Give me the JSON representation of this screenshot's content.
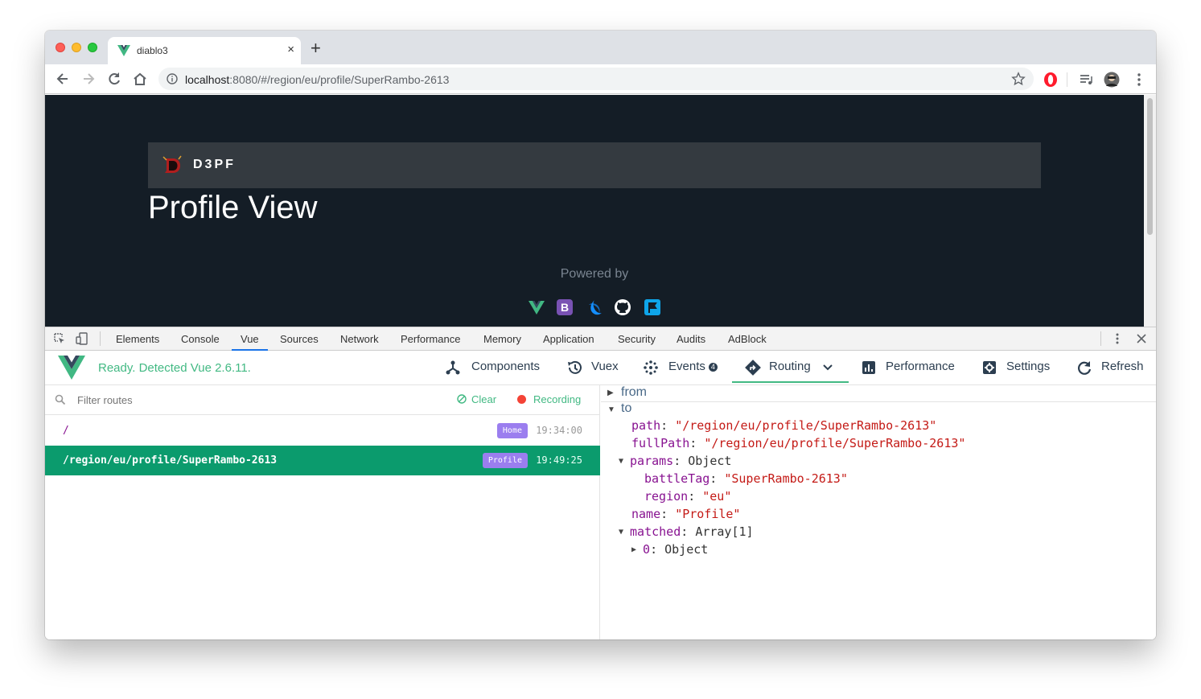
{
  "browser": {
    "tab_title": "diablo3",
    "tab_close": "×",
    "new_tab": "+",
    "url_host": "localhost",
    "url_rest": ":8080/#/region/eu/profile/SuperRambo-2613"
  },
  "page": {
    "brand": "D3PF",
    "title": "Profile View",
    "powered_by": "Powered by",
    "powered_icons": [
      "vue-icon",
      "bootstrap-icon",
      "battlenet-icon",
      "github-icon",
      "netlify-icon"
    ]
  },
  "devtools": {
    "tabs": [
      "Elements",
      "Console",
      "Vue",
      "Sources",
      "Network",
      "Performance",
      "Memory",
      "Application",
      "Security",
      "Audits",
      "AdBlock"
    ],
    "active_tab": "Vue"
  },
  "vue": {
    "status": "Ready. Detected Vue 2.6.11.",
    "tabs": {
      "components": "Components",
      "vuex": "Vuex",
      "events": "Events",
      "events_count": "4",
      "routing": "Routing",
      "performance": "Performance",
      "settings": "Settings",
      "refresh": "Refresh"
    },
    "accent": "#42b983"
  },
  "routes": {
    "filter_placeholder": "Filter routes",
    "clear_label": "Clear",
    "recording_label": "Recording",
    "items": [
      {
        "path": "/",
        "name": "Home",
        "time": "19:34:00",
        "selected": false
      },
      {
        "path": "/region/eu/profile/SuperRambo-2613",
        "name": "Profile",
        "time": "19:49:25",
        "selected": true
      }
    ]
  },
  "inspector": {
    "from_label": "from",
    "to_label": "to",
    "path_key": "path",
    "path_val": "\"/region/eu/profile/SuperRambo-2613\"",
    "fullpath_key": "fullPath",
    "fullpath_val": "\"/region/eu/profile/SuperRambo-2613\"",
    "params_key": "params",
    "params_val": "Object",
    "battletag_key": "battleTag",
    "battletag_val": "\"SuperRambo-2613\"",
    "region_key": "region",
    "region_val": "\"eu\"",
    "name_key": "name",
    "name_val": "\"Profile\"",
    "matched_key": "matched",
    "matched_val": "Array[1]",
    "zero_key": "0",
    "zero_val": "Object"
  }
}
